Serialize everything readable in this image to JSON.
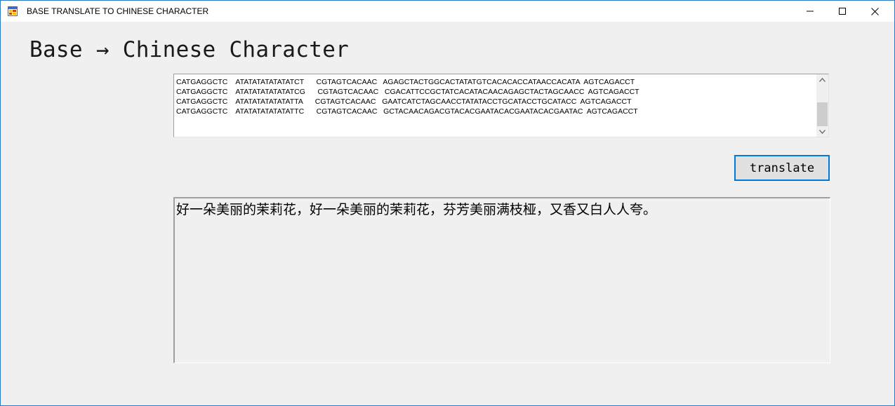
{
  "window": {
    "title": "BASE TRANSLATE TO CHINESE CHARACTER",
    "icon": "winforms-app-icon",
    "controls": {
      "minimize": "minimize-icon",
      "maximize": "maximize-icon",
      "close": "close-icon"
    }
  },
  "heading": "Base → Chinese Character",
  "sequence_input": {
    "lines": [
      "CATGAGGCTC    ATATATATATATATCT      CGTAGTCACAAC   AGAGCTACTGGCACTATATGTCACACACCATAACCACATA  AGTCAGACCT",
      "CATGAGGCTC    ATATATATATATATCG      CGTAGTCACAAC   CGACATTCCGCTATCACATACAACAGAGCTACTAGCAACC  AGTCAGACCT",
      "CATGAGGCTC    ATATATATATATATTA      CGTAGTCACAAC   GAATCATCTAGCAACCTATATACCTGCATACCTGCATACC  AGTCAGACCT",
      "CATGAGGCTC    ATATATATATATATTC      CGTAGTCACAAC   GCTACAACAGACGTACACGAATACACGAATACACGAATAC  AGTCAGACCT"
    ]
  },
  "translate_button": {
    "label": "translate"
  },
  "output": {
    "text": "好一朵美丽的茉莉花，好一朵美丽的茉莉花，芬芳美丽满枝桠，又香又白人人夸。"
  },
  "colors": {
    "accent": "#0078d7",
    "window_border": "#2b79c2",
    "background": "#f0f0f0"
  }
}
